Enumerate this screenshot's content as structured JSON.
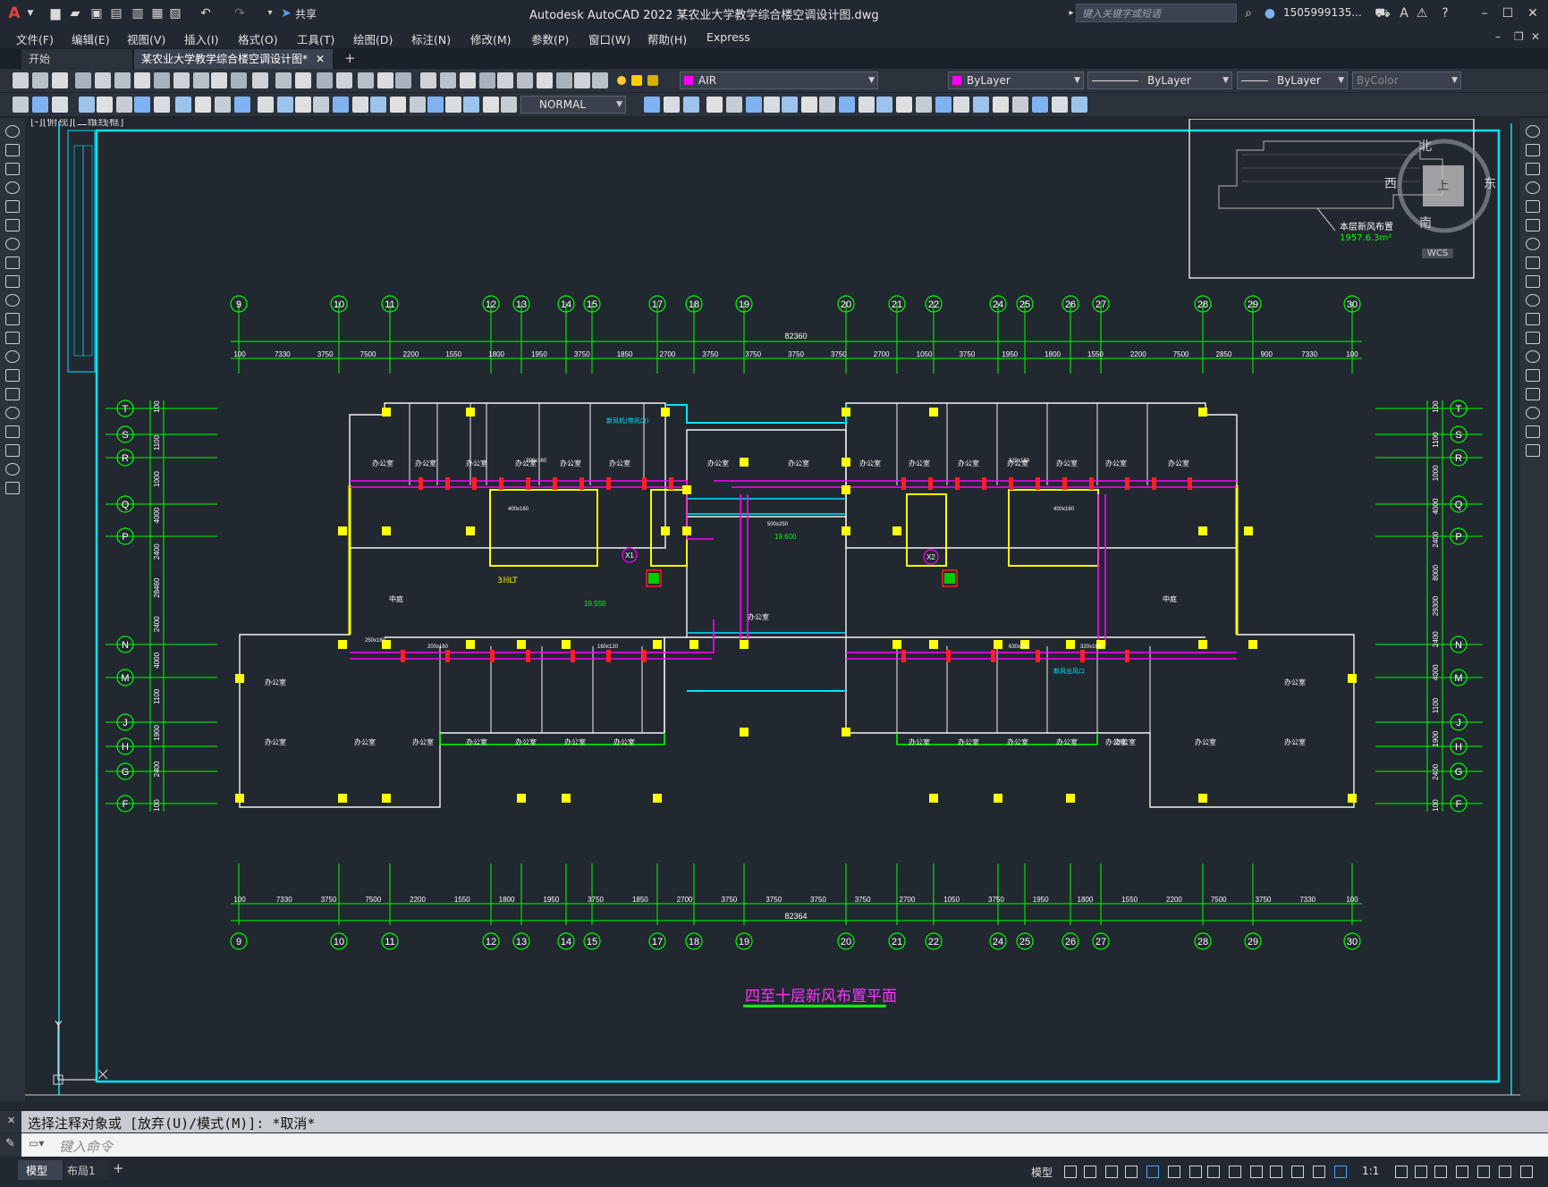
{
  "window": {
    "app_title": "Autodesk AutoCAD 2022    某农业大学教学综合楼空调设计图.dwg",
    "share_label": "共享",
    "search_placeholder": "键入关键字或短语",
    "user_name": "1505999135...",
    "logo_letter": "A"
  },
  "menu": [
    "文件(F)",
    "编辑(E)",
    "视图(V)",
    "插入(I)",
    "格式(O)",
    "工具(T)",
    "绘图(D)",
    "标注(N)",
    "修改(M)",
    "参数(P)",
    "窗口(W)",
    "帮助(H)",
    "Express"
  ],
  "tabs": [
    {
      "label": "开始",
      "active": false
    },
    {
      "label": "某农业大学教学综合楼空调设计图*",
      "active": true
    }
  ],
  "toolbar": {
    "layer_name": "AIR",
    "color_value": "ByLayer",
    "linetype_value": "ByLayer",
    "lineweight_value": "ByLayer",
    "plotstyle_value": "ByColor",
    "textstyle_value": "NORMAL"
  },
  "viewport": {
    "label": "[-][俯视][二维线框]",
    "viewcube": {
      "north": "北",
      "south": "南",
      "east": "东",
      "west": "西",
      "center": "上",
      "wcs": "WCS"
    },
    "keyplan": {
      "area_label": "1957.6.3m²",
      "note": "本层新风布置"
    }
  },
  "drawing": {
    "title": "四至十层新风布置平面",
    "top_axes": [
      "9",
      "10",
      "11",
      "12",
      "13",
      "14",
      "15",
      "17",
      "18",
      "19",
      "20",
      "21",
      "22",
      "24",
      "25",
      "26",
      "27",
      "28",
      "29",
      "30"
    ],
    "top_dims": [
      "100",
      "7330",
      "3750",
      "7500",
      "2200",
      "1550",
      "1800",
      "1950",
      "3750",
      "1850",
      "2700",
      "3750",
      "3750",
      "3750",
      "3750",
      "2700",
      "1050",
      "3750",
      "1950",
      "1800",
      "1550",
      "2200",
      "7500",
      "2850",
      "900",
      "7330",
      "100"
    ],
    "top_total": "82360",
    "bottom_total": "82364",
    "bottom_dims": [
      "100",
      "7330",
      "3750",
      "7500",
      "2200",
      "1550",
      "1800",
      "1950",
      "3750",
      "1850",
      "2700",
      "3750",
      "3750",
      "3750",
      "3750",
      "2700",
      "1050",
      "3750",
      "1950",
      "1800",
      "1550",
      "2200",
      "7500",
      "3750",
      "7330",
      "100"
    ],
    "left_axes": [
      "T",
      "S",
      "R",
      "Q",
      "P",
      "N",
      "M",
      "J",
      "H",
      "G",
      "F"
    ],
    "right_axes": [
      "T",
      "S",
      "R",
      "Q",
      "P",
      "N",
      "M",
      "J",
      "H",
      "G",
      "F"
    ],
    "left_dims": [
      "100",
      "1100",
      "1000",
      "4000",
      "2400",
      "28460",
      "2400",
      "4000",
      "1100",
      "1900",
      "2400",
      "100"
    ],
    "right_dims": [
      "100",
      "1100",
      "1000",
      "4000",
      "2400",
      "8000",
      "29300",
      "2400",
      "4000",
      "1100",
      "1900",
      "2400",
      "100"
    ],
    "room_label": "办公室",
    "hall_label": "中庭",
    "level_labels": [
      "19.600",
      "19.550"
    ],
    "elevator_labels": [
      "X1",
      "X2"
    ],
    "stair_label": "3ℍLT",
    "duct_sizes": [
      "200x160",
      "320x160",
      "400x160",
      "500x250",
      "160x120",
      "630x250",
      "250x160"
    ],
    "callouts": [
      "新风机(带风口)",
      "新风出风口"
    ]
  },
  "command": {
    "history_text": "选择注释对象或 [放弃(U)/模式(M)]: *取消*",
    "input_placeholder": "键入命令"
  },
  "status": {
    "layout_tabs": [
      "模型",
      "布局1"
    ],
    "model_label": "模型",
    "scale": "1:1"
  },
  "colors": {
    "accent": "#00ff00",
    "wall": "#ffff00",
    "duct": "#ff00ff",
    "border": "#00e5ff",
    "column": "#ffff00",
    "title_text": "#ff33ff"
  }
}
